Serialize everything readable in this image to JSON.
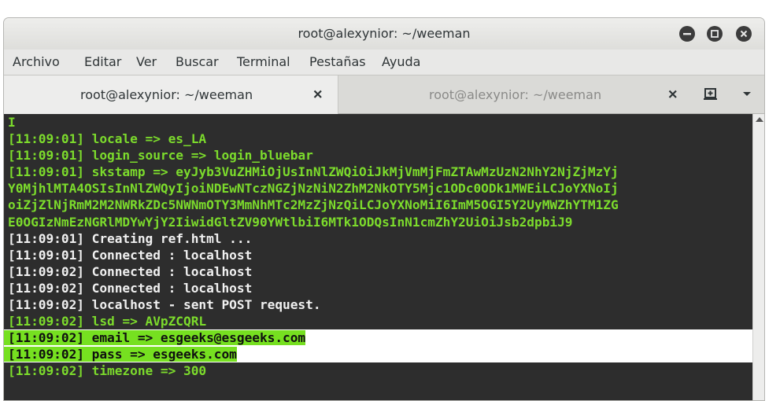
{
  "window": {
    "title": "root@alexynior: ~/weeman"
  },
  "menu": {
    "items": [
      "Archivo",
      "Editar",
      "Ver",
      "Buscar",
      "Terminal",
      "Pestañas",
      "Ayuda"
    ]
  },
  "tabs": [
    {
      "label": "root@alexynior: ~/weeman",
      "active": true
    },
    {
      "label": "root@alexynior: ~/weeman",
      "active": false
    }
  ],
  "icons": {
    "minimize": "minimize-icon",
    "maximize": "maximize-icon",
    "close": "close-icon",
    "tab_close": "close-icon",
    "new_tab": "new-tab-icon",
    "tabs_menu": "chevron-down-icon"
  },
  "colors": {
    "terminal_bg": "#2d2d2d",
    "green_text": "#7cdb2c",
    "white_text": "#f0f0f0",
    "highlight": "#76e020"
  },
  "terminal": {
    "lines": [
      {
        "text": "I",
        "color": "green"
      },
      {
        "text": "[11:09:01] locale => es_LA",
        "color": "green"
      },
      {
        "text": "[11:09:01] login_source => login_bluebar",
        "color": "green"
      },
      {
        "text": "[11:09:01] skstamp => eyJyb3VuZHMiOjUsInNlZWQiOiJkMjVmMjFmZTAwMzUzN2NhY2NjZjMzYj",
        "color": "green"
      },
      {
        "text": "Y0MjhlMTA4OSIsInNlZWQyIjoiNDEwNTczNGZjNzNiN2ZhM2NkOTY5Mjc1ODc0ODk1MWEiLCJoYXNoIj",
        "color": "green"
      },
      {
        "text": "oiZjZlNjRmM2M2NWRkZDc5NWNmOTY3MmNhMTc2MzZjNzQiLCJoYXNoMiI6ImM5OGI5Y2UyMWZhYTM1ZG",
        "color": "green"
      },
      {
        "text": "E0OGIzNmEzNGRlMDYwYjY2IiwidGltZV90YWtlbiI6MTk1ODQsInN1cmZhY2UiOiJsb2dpbiJ9",
        "color": "green"
      },
      {
        "text": "[11:09:01] Creating ref.html ...",
        "color": "white"
      },
      {
        "text": "[11:09:01] Connected : localhost",
        "color": "white"
      },
      {
        "text": "[11:09:02] Connected : localhost",
        "color": "white"
      },
      {
        "text": "[11:09:02] Connected : localhost",
        "color": "white"
      },
      {
        "text": "[11:09:02] localhost - sent POST request.",
        "color": "white"
      },
      {
        "text": "[11:09:02] lsd => AVpZCQRL",
        "color": "green"
      },
      {
        "text": "[11:09:02] email => esgeeks@esgeeks.com",
        "color": "highlight"
      },
      {
        "text": "[11:09:02] pass => esgeeks.com",
        "color": "highlight"
      },
      {
        "text": "[11:09:02] timezone => 300",
        "color": "green"
      }
    ]
  }
}
